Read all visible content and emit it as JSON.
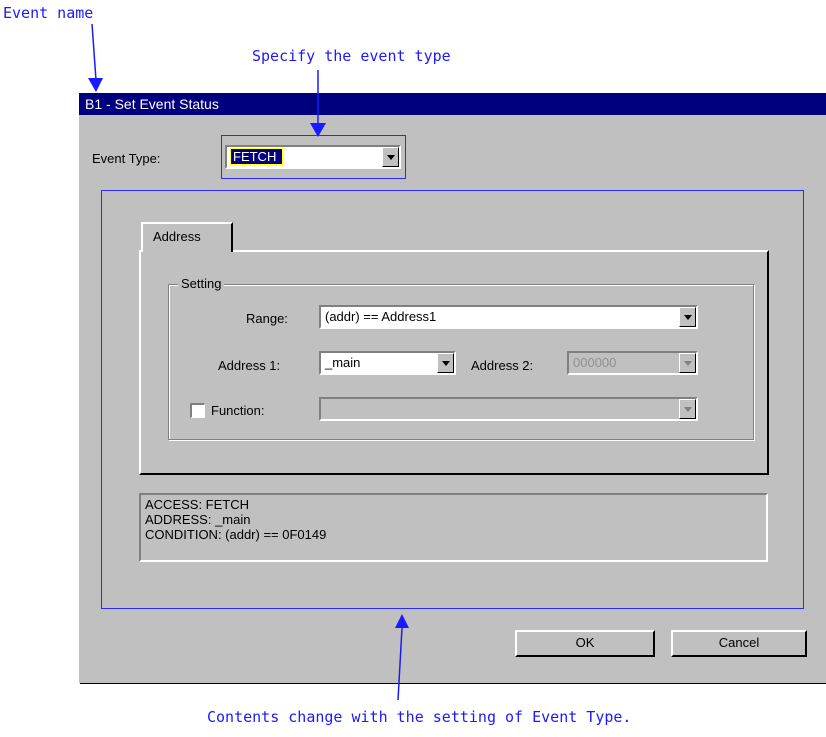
{
  "annotations": {
    "event_name": "Event name",
    "event_type": "Specify the event type",
    "contents_change": "Contents change with the setting of Event Type."
  },
  "dialog": {
    "title": "B1 - Set Event Status",
    "event_type_label": "Event Type:",
    "event_type_value": "FETCH",
    "tab_label": "Address",
    "setting_group_label": "Setting",
    "range_label": "Range:",
    "range_value": "(addr) == Address1",
    "address1_label": "Address 1:",
    "address1_value": "_main",
    "address2_label": "Address 2:",
    "address2_value": "000000",
    "function_label": "Function:",
    "function_value": "",
    "function_checked": false,
    "summary": {
      "line1": "ACCESS: FETCH",
      "line2": "ADDRESS: _main",
      "line3": "CONDITION: (addr) == 0F0149"
    },
    "ok_label": "OK",
    "cancel_label": "Cancel"
  },
  "colors": {
    "titlebar": "#00007f",
    "annotation": "#1a1aff",
    "dialog_face": "#c0c0c0"
  }
}
